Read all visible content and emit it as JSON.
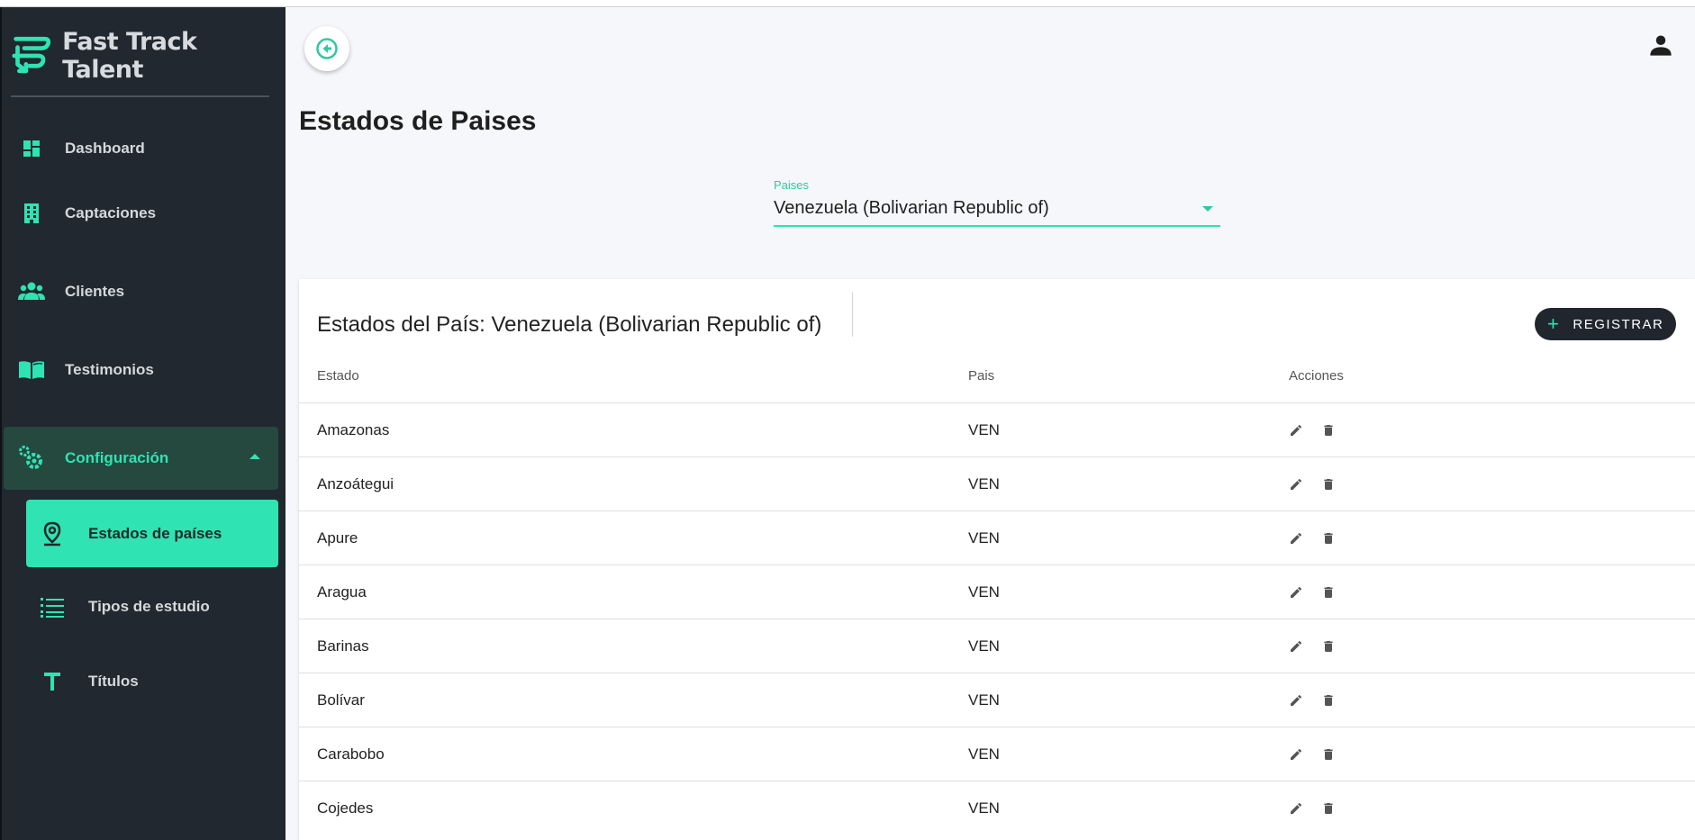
{
  "brand": {
    "name": "Fast Track Talent"
  },
  "sidebar": {
    "items": [
      {
        "label": "Dashboard",
        "icon": "dashboard-icon"
      },
      {
        "label": "Captaciones",
        "icon": "building-icon"
      },
      {
        "label": "Clientes",
        "icon": "people-icon"
      },
      {
        "label": "Testimonios",
        "icon": "book-icon"
      },
      {
        "label": "Configuración",
        "icon": "settings-icon",
        "expanded": true
      }
    ],
    "subitems": [
      {
        "label": "Estados de países",
        "icon": "location-pin-icon",
        "active": true
      },
      {
        "label": "Tipos de estudio",
        "icon": "list-icon"
      },
      {
        "label": "Títulos",
        "icon": "title-t-icon"
      }
    ]
  },
  "header": {
    "back_icon": "back-arrow-icon",
    "user_icon": "user-icon"
  },
  "page": {
    "title": "Estados de Paises"
  },
  "country_select": {
    "label": "Paises",
    "value": "Venezuela (Bolivarian Republic of)"
  },
  "table": {
    "title": "Estados del País: Venezuela (Bolivarian Republic of)",
    "register_label": "REGISTRAR",
    "columns": [
      "Estado",
      "Pais",
      "Acciones"
    ],
    "rows": [
      {
        "estado": "Amazonas",
        "pais": "VEN"
      },
      {
        "estado": "Anzoátegui",
        "pais": "VEN"
      },
      {
        "estado": "Apure",
        "pais": "VEN"
      },
      {
        "estado": "Aragua",
        "pais": "VEN"
      },
      {
        "estado": "Barinas",
        "pais": "VEN"
      },
      {
        "estado": "Bolívar",
        "pais": "VEN"
      },
      {
        "estado": "Carabobo",
        "pais": "VEN"
      },
      {
        "estado": "Cojedes",
        "pais": "VEN"
      }
    ]
  },
  "colors": {
    "accent": "#2fe3b3",
    "sidebar_bg": "#212830",
    "background": "#f6f7fb"
  }
}
